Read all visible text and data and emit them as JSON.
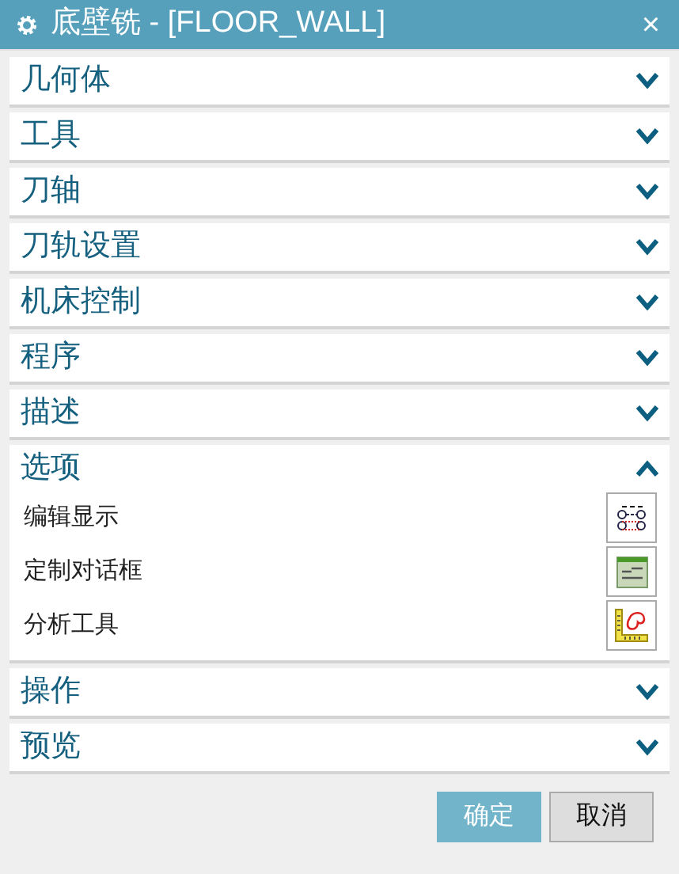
{
  "window": {
    "title": "底壁铣 - [FLOOR_WALL]",
    "close": "×"
  },
  "sections": [
    {
      "label": "几何体",
      "expanded": false
    },
    {
      "label": "工具",
      "expanded": false
    },
    {
      "label": "刀轴",
      "expanded": false
    },
    {
      "label": "刀轨设置",
      "expanded": false
    },
    {
      "label": "机床控制",
      "expanded": false
    },
    {
      "label": "程序",
      "expanded": false
    },
    {
      "label": "描述",
      "expanded": false
    },
    {
      "label": "选项",
      "expanded": true,
      "items": [
        {
          "label": "编辑显示"
        },
        {
          "label": "定制对话框"
        },
        {
          "label": "分析工具"
        }
      ]
    },
    {
      "label": "操作",
      "expanded": false
    },
    {
      "label": "预览",
      "expanded": false
    }
  ],
  "buttons": [
    {
      "label": "确定",
      "kind": "primary"
    },
    {
      "label": "取消",
      "kind": "secondary"
    }
  ]
}
